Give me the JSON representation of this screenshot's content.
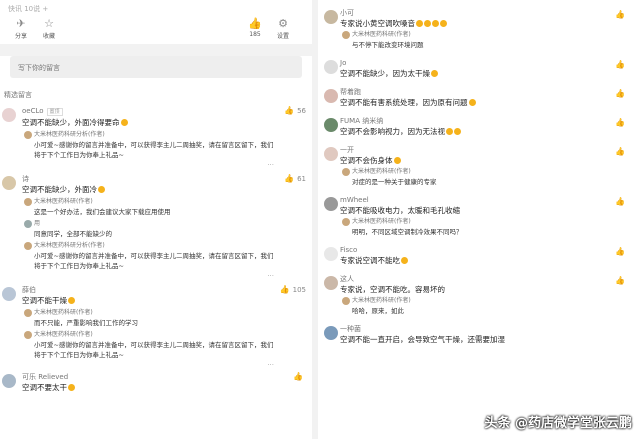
{
  "left": {
    "top_faded": "快讯 10说 +",
    "tools": [
      {
        "icon": "✈",
        "label": "分享"
      },
      {
        "icon": "☆",
        "label": "收藏"
      },
      {
        "icon": "👍",
        "label": "185"
      },
      {
        "icon": "⚙",
        "label": "设置"
      }
    ],
    "input_placeholder": "写下你的留言",
    "section_title": "精选留言",
    "comments": [
      {
        "user": "oeCLo",
        "tag": "置顶",
        "text": "空调不能缺少，外面冷得要命",
        "likes": "56",
        "reply": {
          "user": "大米林医药科研分析(作者)",
          "text": "小可爱~感谢你的留言并准备中，可以获得李主儿二周抽奖，请在留言区留下，我们将于下个工作日为你奉上礼品~"
        }
      },
      {
        "user": "诗",
        "tag": "",
        "text": "空调不能缺少，外面冷",
        "likes": "61",
        "reply": {
          "user": "大米林医药科研(作者)",
          "text": "这是一个好办法，我们会建议大家下载应用使用"
        },
        "reply2": {
          "user": "用",
          "text": "同意同学，全部不能缺少的"
        },
        "reply3": {
          "user": "大米林医药科研分析(作者)",
          "text": "小可爱~感谢你的留言并准备中，可以获得李主儿二周抽奖，请在留言区留下，我们将于下个工作日为你奉上礼品~"
        }
      },
      {
        "user": "薛伯",
        "tag": "",
        "text": "空调不能干燥",
        "likes": "105",
        "reply": {
          "user": "大米林医药科研(作者)",
          "text": "而不只能，严重影响我们工作的学习"
        },
        "reply2": {
          "user": "大米林医药科研(作者)",
          "text": "小可爱~感谢你的留言并准备中，可以获得李主儿二周抽奖，请在留言区留下，我们将于下个工作日为你奉上礼品~"
        }
      },
      {
        "user": "可乐 Relieved",
        "tag": "",
        "text": "空调不要太干",
        "likes": "",
        "reply": null
      }
    ]
  },
  "right": {
    "comments": [
      {
        "user": "小可",
        "text": "专家说小黄空调吹嗓音",
        "reply_user": "大米林医药科研(作者)",
        "reply_text": "与不停下能改变环境问题"
      },
      {
        "user": "Jo",
        "text": "空调不能缺少，因为太干燥",
        "reply_user": "",
        "reply_text": ""
      },
      {
        "user": "帮着跑",
        "text": "空调不能有害系统处理，因为原有问题",
        "reply_user": "",
        "reply_text": ""
      },
      {
        "user": "FUMA 纳米纳",
        "text": "空调不会影响视力，因为无法视",
        "reply_user": "",
        "reply_text": ""
      },
      {
        "user": "一开",
        "text": "空调不会伤身体",
        "reply_user": "大米林医药科研(作者)",
        "reply_text": "对症的是一种关于健康的专家"
      },
      {
        "user": "mWheel",
        "text": "空调不能吸收电力，太暖和毛孔收缩",
        "reply_user": "大米林医药科研(作者)",
        "reply_text": "明明，不同区域空调制冷效果不同吗？"
      },
      {
        "user": "Fisco",
        "text": "专家说空调不能吃",
        "reply_user": "",
        "reply_text": ""
      },
      {
        "user": "这人",
        "text": "专家说，空调不能吃。容易坏的",
        "reply_user": "大米林医药科研(作者)",
        "reply_text": "哈哈，原来，如此"
      },
      {
        "user": "一种菌",
        "text": "空调不能一直开启，会导致空气干燥，还需要加湿",
        "reply_user": "",
        "reply_text": ""
      }
    ],
    "like_icon": "👍"
  },
  "watermark": "头条 @药店微学堂张云鹏"
}
